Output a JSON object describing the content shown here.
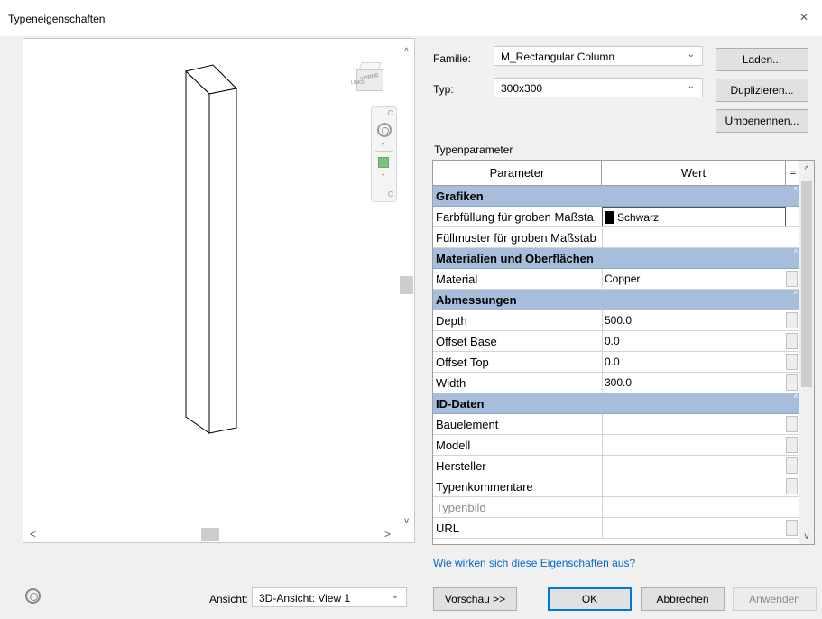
{
  "window": {
    "title": "Typeneigenschaften",
    "close": "×"
  },
  "form": {
    "familie_label": "Familie:",
    "familie_value": "M_Rectangular Column",
    "typ_label": "Typ:",
    "typ_value": "300x300",
    "laden_button": "Laden...",
    "duplizieren_button": "Duplizieren...",
    "umbenennen_button": "Umbenennen...",
    "typenparameter_label": "Typenparameter"
  },
  "table": {
    "col_parameter": "Parameter",
    "col_wert": "Wert",
    "col_eq": "=",
    "rows": [
      {
        "kind": "group",
        "name": "Grafiken"
      },
      {
        "kind": "param",
        "name": "Farbfüllung für groben Maßsta",
        "value": "Schwarz",
        "swatch": "#000000",
        "selected": true
      },
      {
        "kind": "param",
        "name": "Füllmuster für groben Maßstab",
        "value": ""
      },
      {
        "kind": "group",
        "name": "Materialien und Oberflächen"
      },
      {
        "kind": "param",
        "name": "Material",
        "value": "Copper",
        "btn": true
      },
      {
        "kind": "group",
        "name": "Abmessungen"
      },
      {
        "kind": "param",
        "name": "Depth",
        "value": "500.0",
        "btn": true
      },
      {
        "kind": "param",
        "name": "Offset Base",
        "value": "0.0",
        "btn": true
      },
      {
        "kind": "param",
        "name": "Offset Top",
        "value": "0.0",
        "btn": true
      },
      {
        "kind": "param",
        "name": "Width",
        "value": "300.0",
        "btn": true
      },
      {
        "kind": "group",
        "name": "ID-Daten"
      },
      {
        "kind": "param",
        "name": "Bauelement",
        "value": "",
        "btn": true
      },
      {
        "kind": "param",
        "name": "Modell",
        "value": "",
        "btn": true
      },
      {
        "kind": "param",
        "name": "Hersteller",
        "value": "",
        "btn": true
      },
      {
        "kind": "param",
        "name": "Typenkommentare",
        "value": "",
        "btn": true
      },
      {
        "kind": "param",
        "name": "Typenbild",
        "value": "",
        "dim": true
      },
      {
        "kind": "param",
        "name": "URL",
        "value": "",
        "btn": true
      }
    ]
  },
  "preview": {
    "viewcube_front": "VORNE",
    "viewcube_left": "LINKS"
  },
  "help_link": "Wie wirken sich diese Eigenschaften aus?",
  "footer": {
    "ansicht_label": "Ansicht:",
    "ansicht_value": "3D-Ansicht: View 1",
    "vorschau_button": "Vorschau >>",
    "ok_button": "OK",
    "abbrechen_button": "Abbrechen",
    "anwenden_button": "Anwenden"
  }
}
